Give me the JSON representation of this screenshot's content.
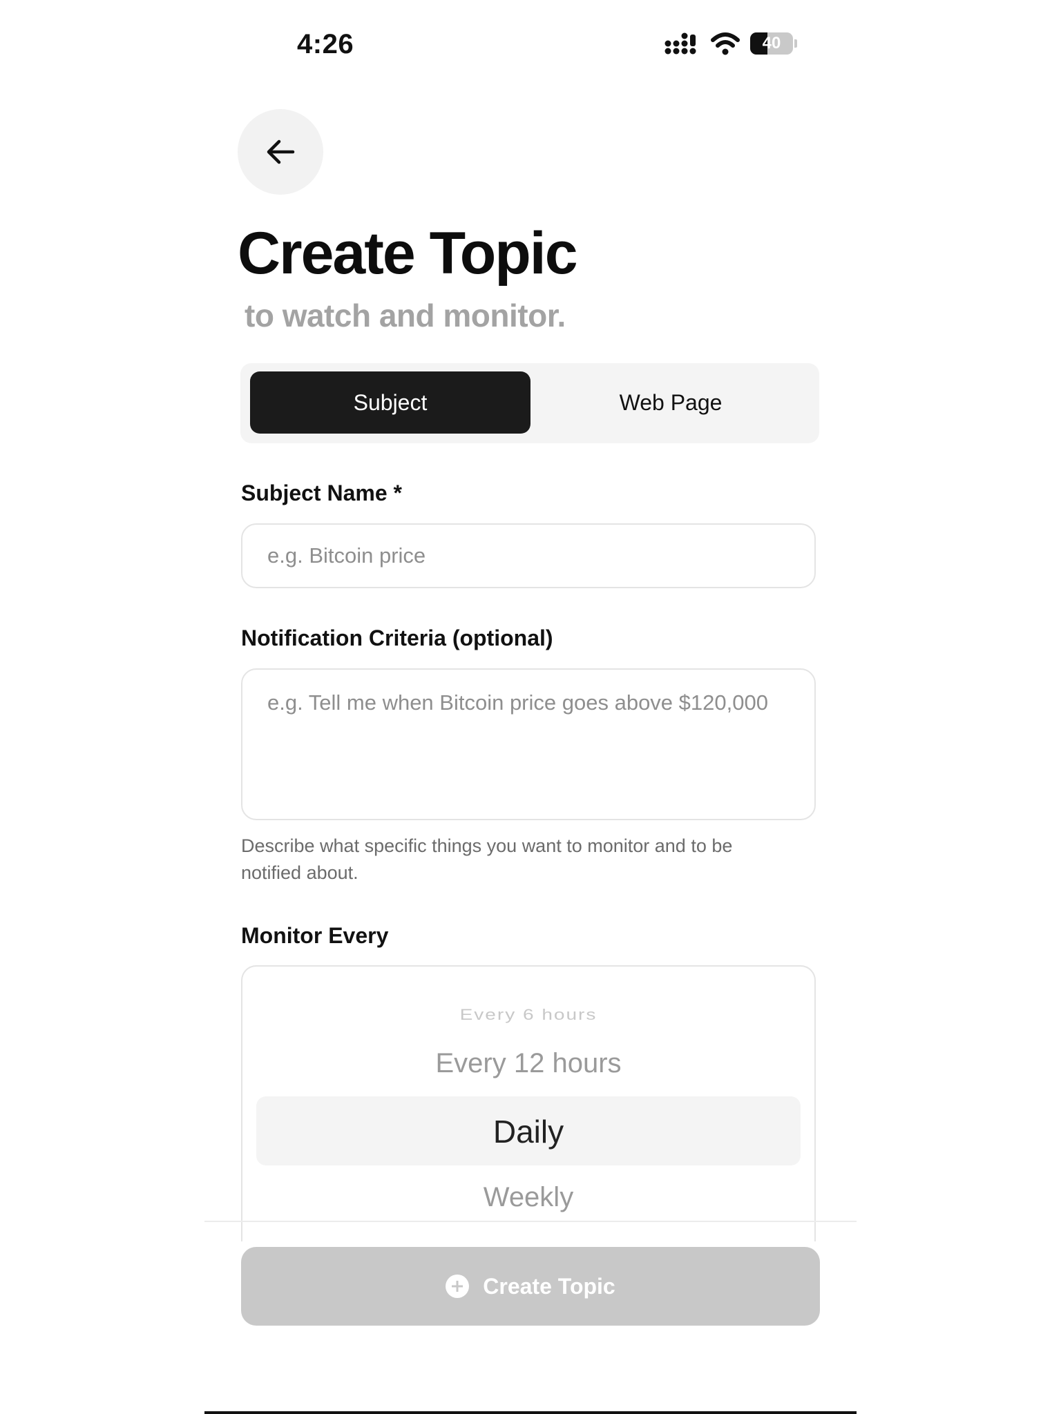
{
  "status_bar": {
    "time": "4:26",
    "battery": "40"
  },
  "header": {
    "title": "Create Topic",
    "subtitle": "to watch and monitor."
  },
  "segmented": {
    "options": [
      "Subject",
      "Web Page"
    ],
    "selected": "Subject"
  },
  "subject_name": {
    "label": "Subject Name *",
    "placeholder": "e.g. Bitcoin price",
    "value": ""
  },
  "criteria": {
    "label": "Notification Criteria (optional)",
    "placeholder": "e.g. Tell me when Bitcoin price goes above $120,000",
    "helper": "Describe what specific things you want to monitor and to be notified about."
  },
  "monitor": {
    "label": "Monitor Every",
    "options": [
      "Every 6 hours",
      "Every 12 hours",
      "Daily",
      "Weekly"
    ],
    "selected": "Daily"
  },
  "action": {
    "create_label": "Create Topic"
  }
}
